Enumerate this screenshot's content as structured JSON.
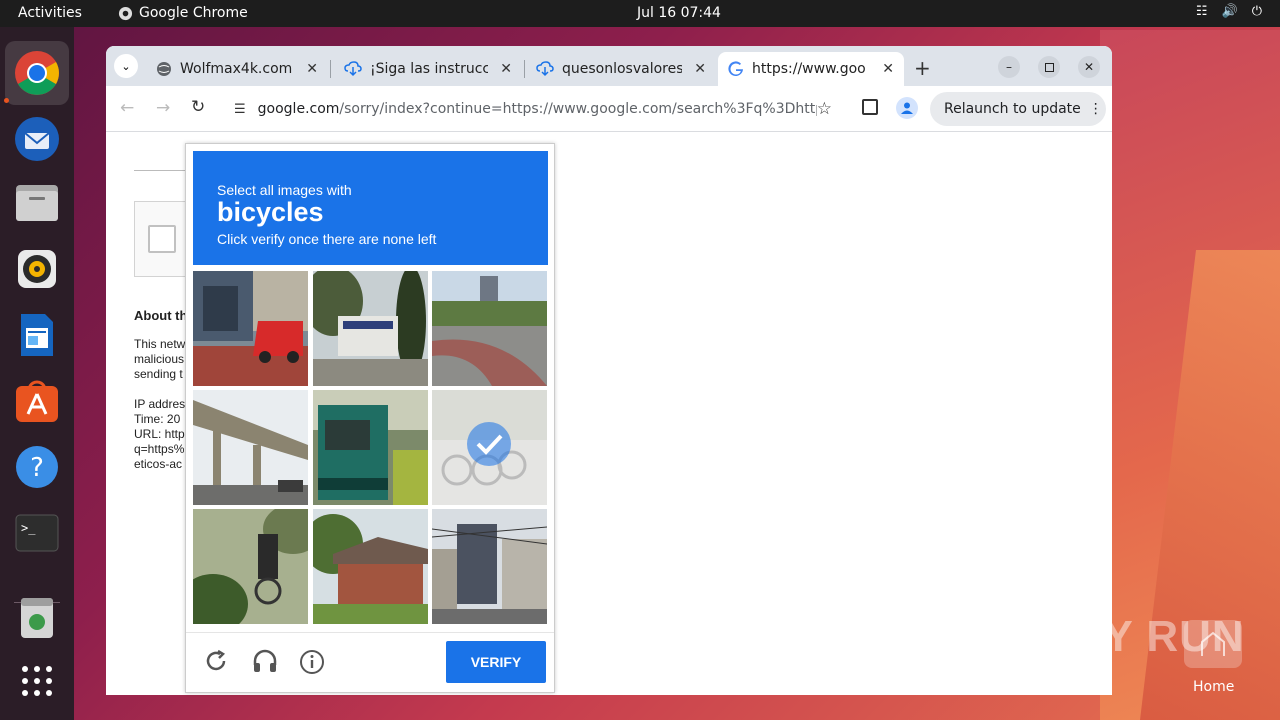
{
  "topbar": {
    "activities": "Activities",
    "app_name": "Google Chrome",
    "clock": "Jul 16  07:44"
  },
  "tabs": [
    {
      "title": "Wolfmax4k.com :",
      "favicon": "globe-icon"
    },
    {
      "title": "¡Siga las instrucci",
      "favicon": "download-icon"
    },
    {
      "title": "quesonlosvalores",
      "favicon": "download-icon"
    },
    {
      "title": "https://www.goo",
      "favicon": "google-icon"
    }
  ],
  "toolbar": {
    "url_domain": "google.com",
    "url_path": "/sorry/index?continue=https://www.google.com/search%3Fq%3Dhttps...",
    "relaunch_label": "Relaunch to update"
  },
  "page": {
    "about": "About th",
    "line1": "This netw",
    "line2": "malicious",
    "line3": "sending t",
    "ip": "IP addres",
    "time": "Time: 20",
    "url": "URL: http",
    "q": "q=https%",
    "eticos": "eticos-ac"
  },
  "captcha": {
    "prompt": "Select all images with",
    "object": "bicycles",
    "instruction": "Click verify once there are none left",
    "verify_label": "VERIFY",
    "tiles": [
      {
        "scene": "street-red-van",
        "selected": false
      },
      {
        "scene": "shop-trees",
        "selected": false
      },
      {
        "scene": "road-curve",
        "selected": false
      },
      {
        "scene": "overpass",
        "selected": false
      },
      {
        "scene": "green-truck",
        "selected": false
      },
      {
        "scene": "bicycles-parked",
        "selected": true
      },
      {
        "scene": "cyclist-foliage",
        "selected": false
      },
      {
        "scene": "brick-house",
        "selected": false
      },
      {
        "scene": "city-street",
        "selected": false
      }
    ]
  },
  "watermark": "ANY RUN",
  "desktop": {
    "home_label": "Home"
  },
  "colors": {
    "google_blue": "#1a73e8",
    "ubuntu_orange": "#e95420"
  }
}
